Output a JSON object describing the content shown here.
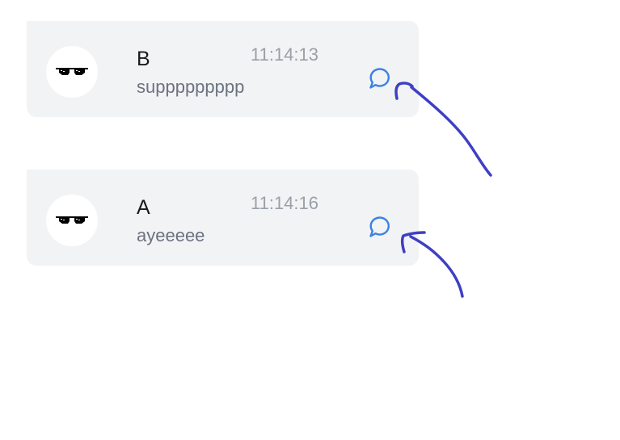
{
  "messages": [
    {
      "sender": "B",
      "time": "11:14:13",
      "text": "suppppppppp",
      "avatar_icon": "deal-with-it-sunglasses-icon",
      "reply_icon": "chat-bubble-icon"
    },
    {
      "sender": "A",
      "time": "11:14:16",
      "text": "ayeeeee",
      "avatar_icon": "deal-with-it-sunglasses-icon",
      "reply_icon": "chat-bubble-icon"
    }
  ],
  "colors": {
    "card_background": "#f2f3f5",
    "reply_icon": "#3b82e6",
    "annotation_arrow": "#3f3fc4",
    "time_text": "#9aa0a8",
    "message_text": "#6b7280"
  }
}
